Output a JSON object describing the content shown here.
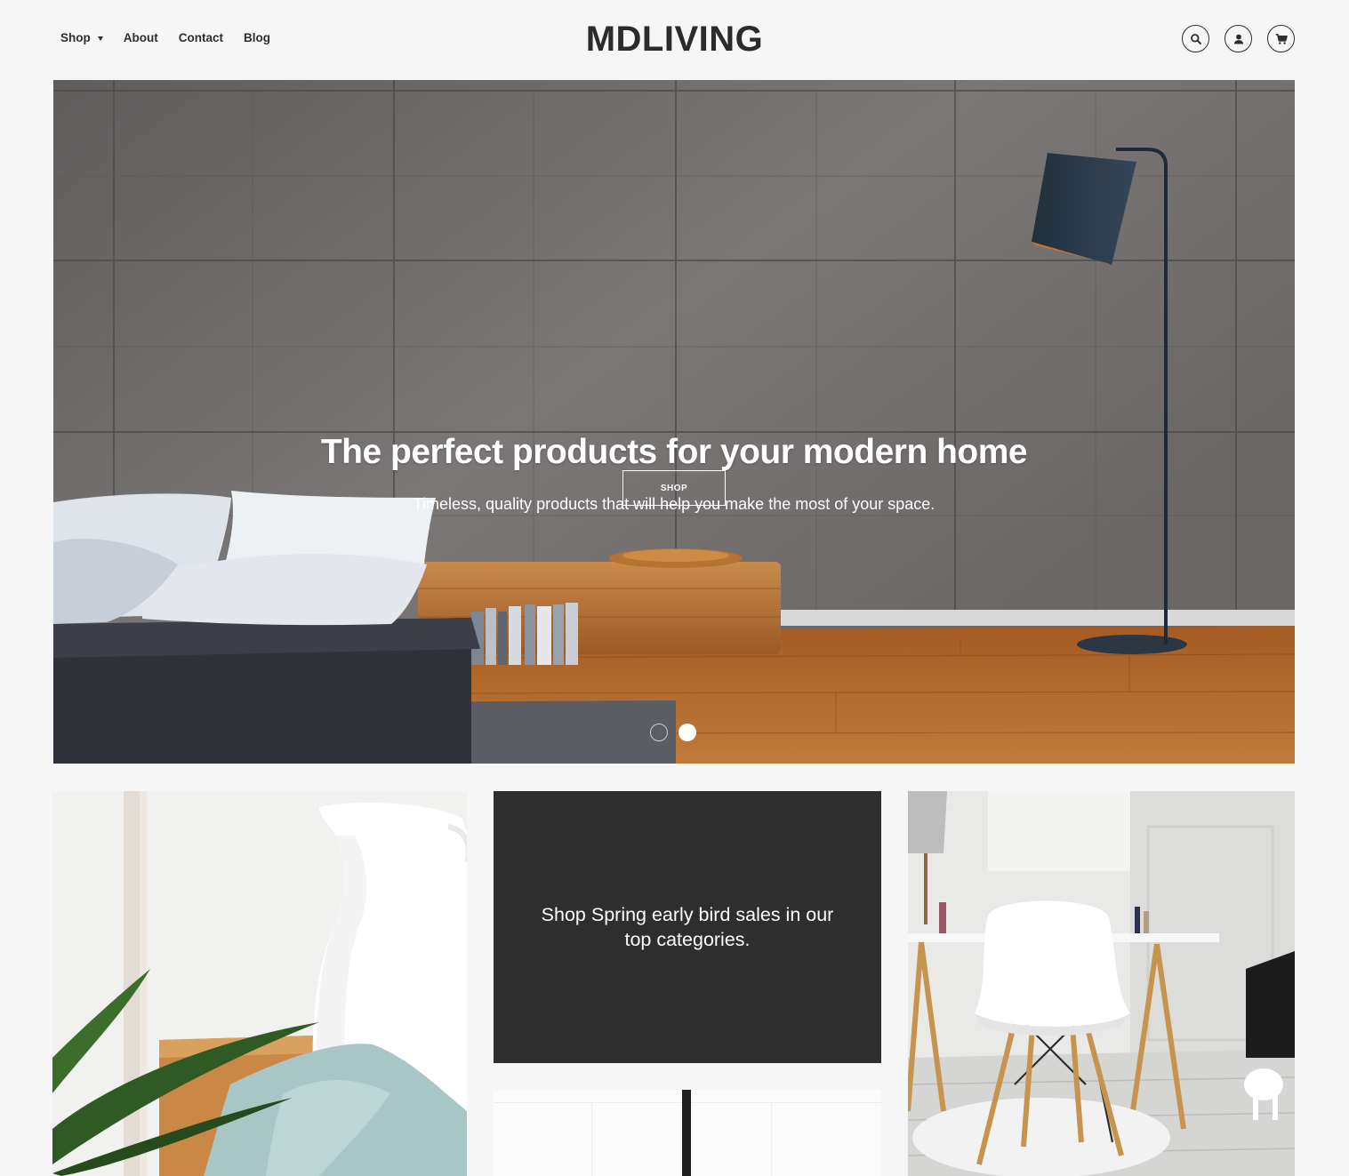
{
  "header": {
    "nav": [
      {
        "label": "Shop",
        "has_dropdown": true
      },
      {
        "label": "About"
      },
      {
        "label": "Contact"
      },
      {
        "label": "Blog"
      }
    ],
    "logo": "MDLIVING",
    "icons": [
      "search-icon",
      "account-icon",
      "cart-icon"
    ]
  },
  "hero": {
    "title": "The perfect products for your modern home",
    "subtitle": "Timeless, quality products that will help you make the most of your space.",
    "button_label": "SHOP",
    "slides_total": 2,
    "active_slide": 2
  },
  "promo": {
    "text": "Shop Spring early bird sales in our top categories."
  },
  "colors": {
    "background": "#f6f6f6",
    "text": "#2c2c2c",
    "promo_bg": "#2e2e2e",
    "hero_wall": "#6b6868",
    "wood": "#b06a2e"
  }
}
